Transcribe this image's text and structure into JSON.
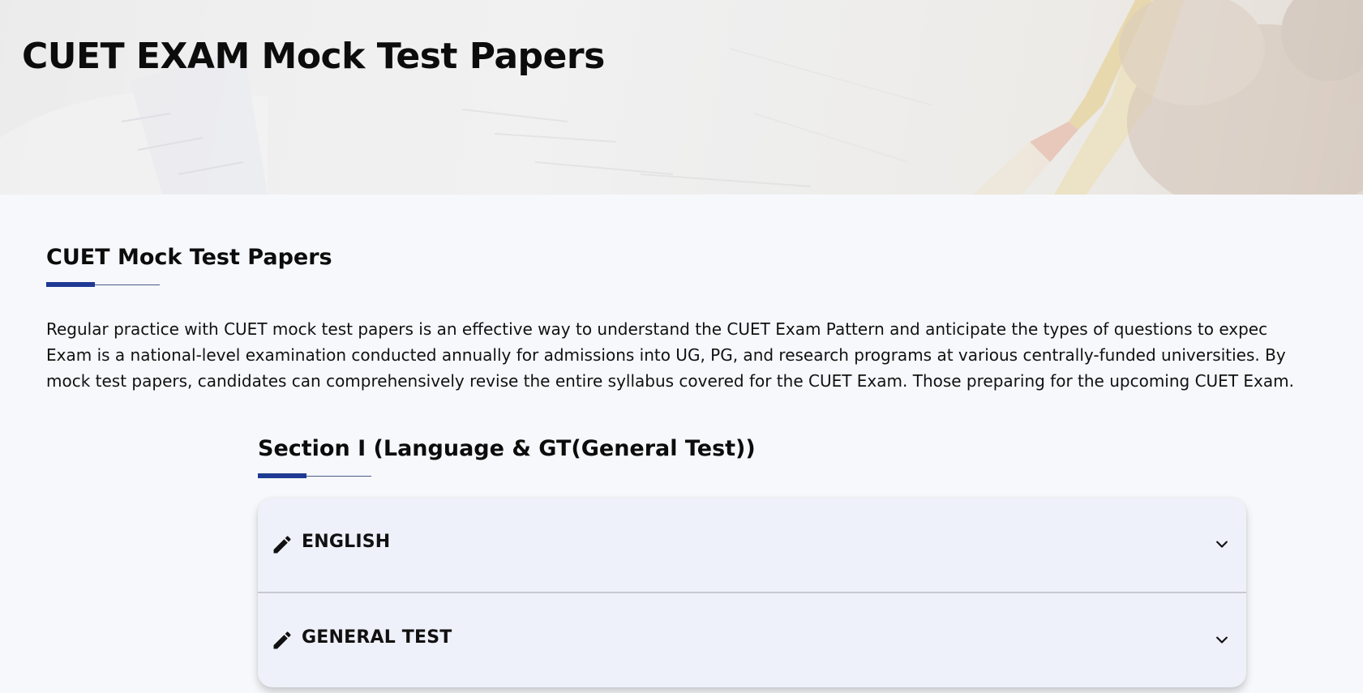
{
  "hero": {
    "title": "CUET EXAM Mock Test Papers"
  },
  "main": {
    "heading": "CUET Mock Test Papers",
    "intro_lines": [
      "Regular practice with CUET mock test papers is an effective way to understand the CUET Exam Pattern and anticipate the types of questions to expec",
      "Exam is a national-level examination conducted annually for admissions into UG, PG, and research programs at various centrally-funded universities. By",
      "mock test papers, candidates can comprehensively revise the entire syllabus covered for the CUET Exam. Those preparing for the upcoming CUET Exam."
    ]
  },
  "section1": {
    "heading": "Section I (Language & GT(General Test))",
    "accordion": [
      {
        "label": "ENGLISH",
        "icon": "pencil-icon"
      },
      {
        "label": "GENERAL TEST",
        "icon": "pencil-icon"
      }
    ]
  },
  "colors": {
    "accent": "#1f3a93",
    "page_bg": "#f7f8fb",
    "accordion_bg": "#eef1fa"
  }
}
